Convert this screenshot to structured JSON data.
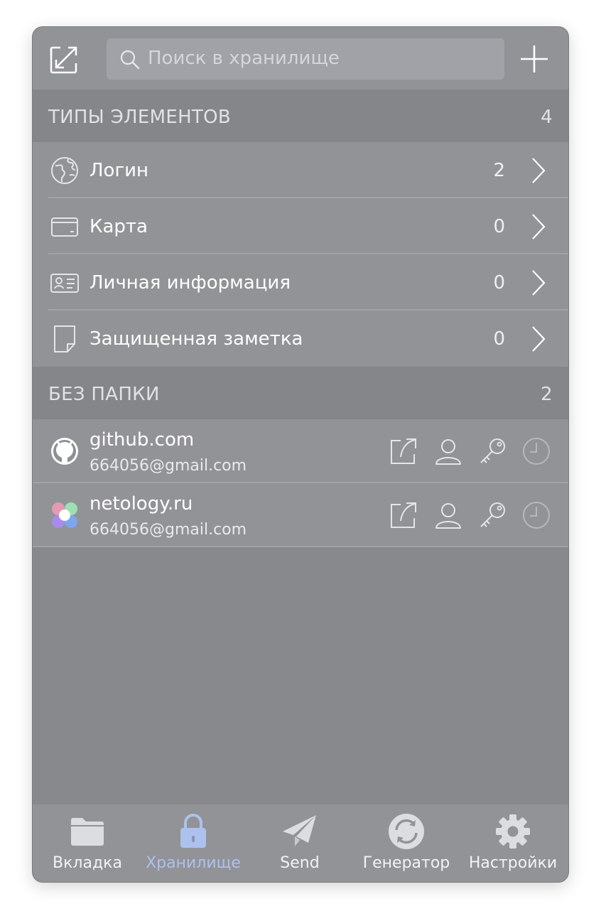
{
  "search": {
    "placeholder": "Поиск в хранилище"
  },
  "types_section": {
    "title": "ТИПЫ ЭЛЕМЕНТОВ",
    "count": "4"
  },
  "types": [
    {
      "label": "Логин",
      "count": "2",
      "icon": "globe-icon"
    },
    {
      "label": "Карта",
      "count": "0",
      "icon": "credit-card-icon"
    },
    {
      "label": "Личная информация",
      "count": "0",
      "icon": "id-card-icon"
    },
    {
      "label": "Защищенная заметка",
      "count": "0",
      "icon": "note-icon"
    }
  ],
  "folder_section": {
    "title": "БЕЗ ПАПКИ",
    "count": "2"
  },
  "items": [
    {
      "name": "github.com",
      "username": "664056@gmail.com",
      "icon": "github-icon"
    },
    {
      "name": "netology.ru",
      "username": "664056@gmail.com",
      "icon": "netology-icon"
    }
  ],
  "tabs": [
    {
      "label": "Вкладка",
      "icon": "folder-icon",
      "active": false
    },
    {
      "label": "Хранилище",
      "icon": "lock-icon",
      "active": true
    },
    {
      "label": "Send",
      "icon": "paper-plane-icon",
      "active": false
    },
    {
      "label": "Генератор",
      "icon": "refresh-icon",
      "active": false
    },
    {
      "label": "Настройки",
      "icon": "gear-icon",
      "active": false
    }
  ],
  "colors": {
    "background": "#88898d",
    "row": "#929397",
    "section_header": "#85868a",
    "active_tab": "#adc1ee"
  }
}
